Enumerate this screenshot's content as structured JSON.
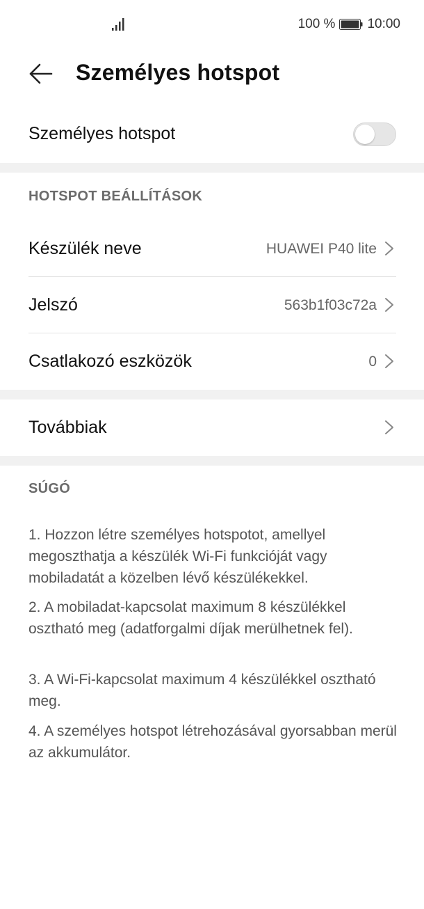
{
  "status_bar": {
    "battery_percent": "100 %",
    "time": "10:00",
    "icons": [
      "signal-icon",
      "battery-icon"
    ]
  },
  "header": {
    "back_icon": "arrow-left-icon",
    "title": "Személyes hotspot"
  },
  "hotspot_toggle": {
    "label": "Személyes hotspot",
    "enabled": false
  },
  "settings_section": {
    "title": "HOTSPOT BEÁLLÍTÁSOK",
    "items": [
      {
        "label": "Készülék neve",
        "value": "HUAWEI P40 lite"
      },
      {
        "label": "Jelszó",
        "value": "563b1f03c72a"
      },
      {
        "label": "Csatlakozó eszközök",
        "value": "0"
      }
    ]
  },
  "more": {
    "label": "Továbbiak"
  },
  "help_section": {
    "title": "SÚGÓ",
    "items": [
      "1. Hozzon létre személyes hotspotot, amellyel megoszthatja a készülék Wi-Fi funkcióját vagy mobiladatát a közelben lévő készülékekkel.",
      "2. A mobiladat-kapcsolat maximum 8 készülékkel osztható meg (adatforgalmi díjak merülhetnek fel).",
      "3. A Wi-Fi-kapcsolat maximum 4 készülékkel osztható meg.",
      "4. A személyes hotspot létrehozásával gyorsabban merül az akkumulátor."
    ]
  },
  "colors": {
    "background": "#ffffff",
    "section_gap": "#f1f1f1",
    "secondary_text": "#666666",
    "toggle_off": "#e6e6e6"
  }
}
